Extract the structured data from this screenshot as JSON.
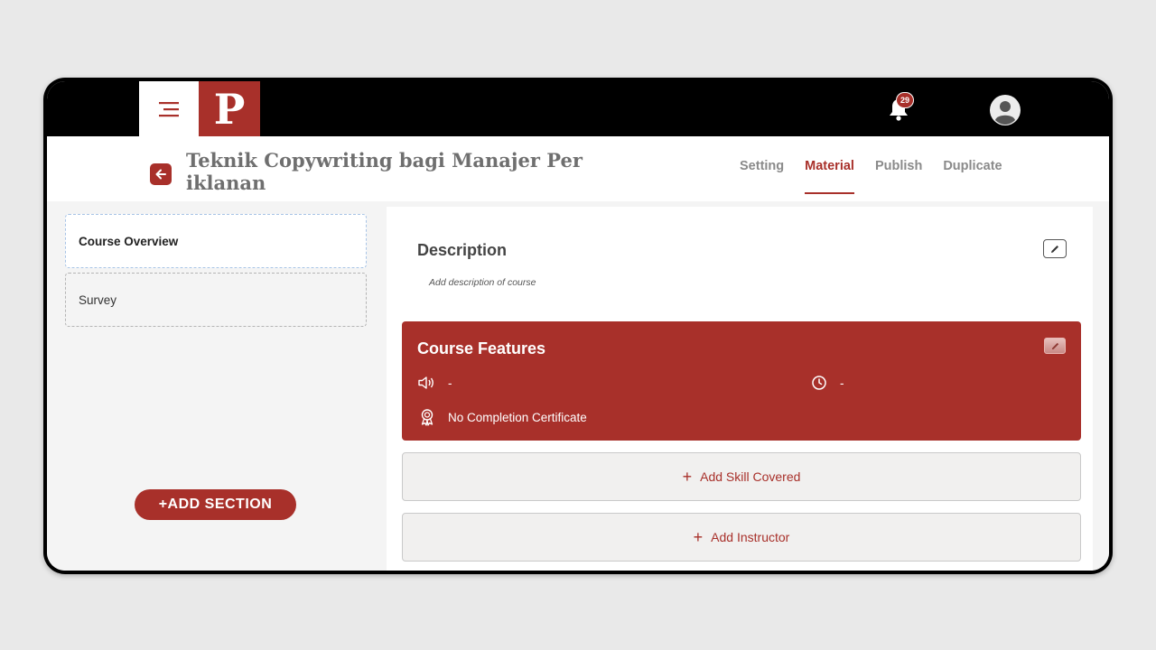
{
  "app": {
    "logo_letter": "P",
    "notification_count": "29",
    "brand_color": "#a8302a"
  },
  "header": {
    "course_title": "Teknik Copywriting bagi Manajer Per iklanan",
    "tabs": [
      {
        "label": "Setting",
        "active": false
      },
      {
        "label": "Material",
        "active": true
      },
      {
        "label": "Publish",
        "active": false
      },
      {
        "label": "Duplicate",
        "active": false
      }
    ]
  },
  "sidebar": {
    "items": [
      {
        "label": "Course Overview",
        "active": true
      },
      {
        "label": "Survey",
        "active": false
      }
    ],
    "add_section_label": "+ADD SECTION"
  },
  "main": {
    "description": {
      "title": "Description",
      "placeholder": "Add description of course"
    },
    "course_features": {
      "title": "Course Features",
      "audio_value": "-",
      "duration_value": "-",
      "certificate_label": "No Completion Certificate"
    },
    "add_skill_label": "Add Skill Covered",
    "add_instructor_label": "Add Instructor"
  },
  "icons": [
    "menu-icon",
    "bell-icon",
    "avatar-icon",
    "back-arrow-icon",
    "pencil-icon",
    "speaker-icon",
    "clock-icon",
    "certificate-icon",
    "plus-icon"
  ]
}
